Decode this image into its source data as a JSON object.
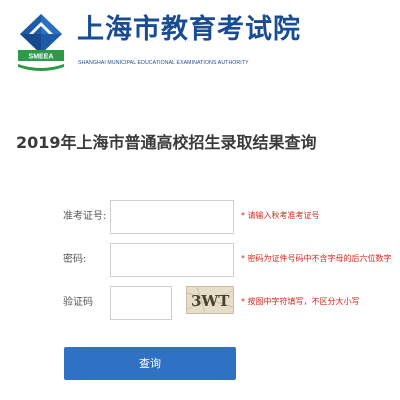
{
  "header": {
    "title": "上海市教育考试院",
    "subtitle": "SHANGHAI MUNICIPAL EDUCATIONAL EXAMINATIONS AUTHORITY",
    "logo_text": "SMEEA",
    "logo_icon": "smeea-logo-icon"
  },
  "page": {
    "title": "2019年上海市普通高校招生录取结果查询"
  },
  "form": {
    "exam_id": {
      "label": "准考证号:",
      "value": "",
      "hint": "* 请输入秋考准考证号"
    },
    "password": {
      "label": "密码:",
      "value": "",
      "hint": "* 密码为证件号码中不含字母的后六位数字"
    },
    "captcha": {
      "label": "验证码",
      "value": "",
      "image_text": "3WT",
      "hint": "* 按图中字符填写，不区分大小写"
    },
    "submit_label": "查询"
  },
  "colors": {
    "brand_blue": "#1a4c94",
    "button_blue": "#2f72c4",
    "hint_red": "#d9261c",
    "logo_green": "#2e9a48"
  }
}
